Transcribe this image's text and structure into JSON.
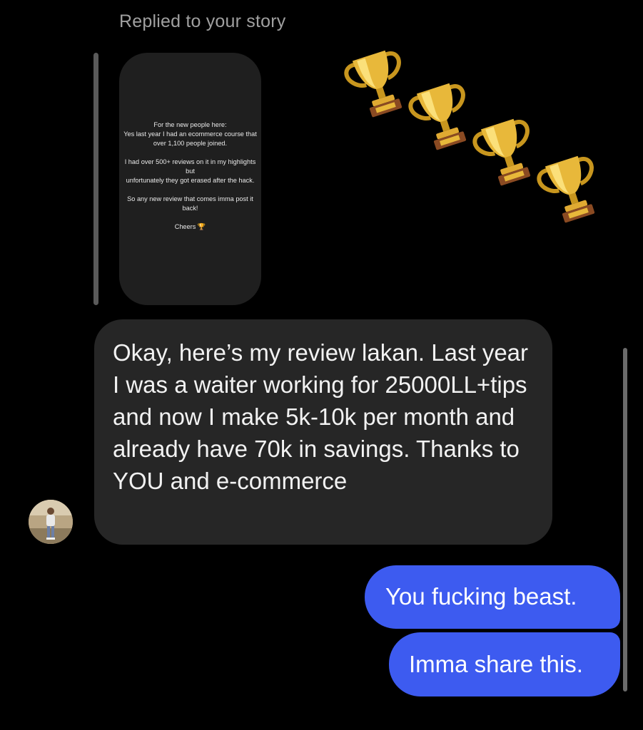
{
  "reply_header": "Replied to your story",
  "story": {
    "lines": [
      "For the new people here:",
      "Yes last year I had an ecommerce course that",
      "over 1,100 people joined.",
      "I had over 500+ reviews on it in my highlights but",
      "unfortunately they got erased after the hack.",
      "So any new review that comes imma post it back!",
      "Cheers 🏆"
    ]
  },
  "reaction": {
    "icon": "trophy-icon",
    "count": 4
  },
  "incoming_message": {
    "text": "Okay, here’s my review lakan. Last year I was a waiter working for 25000LL+tips and now I make 5k-10k per month and already have 70k in savings. Thanks to YOU and e-commerce"
  },
  "outgoing_messages": [
    "You fucking beast.",
    "Imma share this."
  ],
  "colors": {
    "background": "#000000",
    "incoming_bubble": "#262626",
    "outgoing_bubble": "#3d5bf0",
    "story_card": "#1f1f1f",
    "muted_text": "#a0a0a0"
  }
}
